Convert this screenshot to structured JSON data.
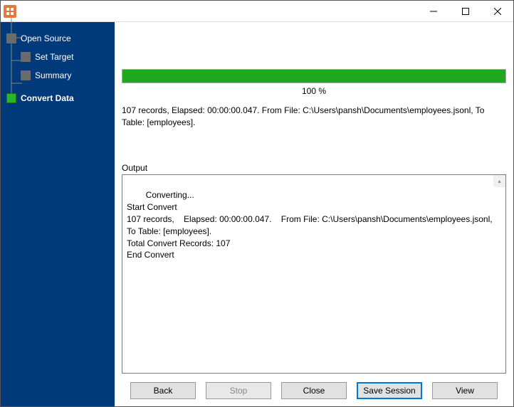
{
  "sidebar": {
    "items": [
      {
        "label": "Open Source",
        "active": false
      },
      {
        "label": "Set Target",
        "active": false
      },
      {
        "label": "Summary",
        "active": false
      },
      {
        "label": "Convert Data",
        "active": true
      }
    ]
  },
  "progress": {
    "percent_label": "100 %",
    "percent_value": 100
  },
  "status_text": "107 records,    Elapsed: 00:00:00.047.    From File: C:\\Users\\pansh\\Documents\\employees.jsonl,    To Table: [employees].",
  "output": {
    "label": "Output",
    "text": "Converting...\nStart Convert\n107 records,    Elapsed: 00:00:00.047.    From File: C:\\Users\\pansh\\Documents\\employees.jsonl,    To Table: [employees].\nTotal Convert Records: 107\nEnd Convert"
  },
  "buttons": {
    "back": "Back",
    "stop": "Stop",
    "close": "Close",
    "save_session": "Save Session",
    "view": "View"
  }
}
